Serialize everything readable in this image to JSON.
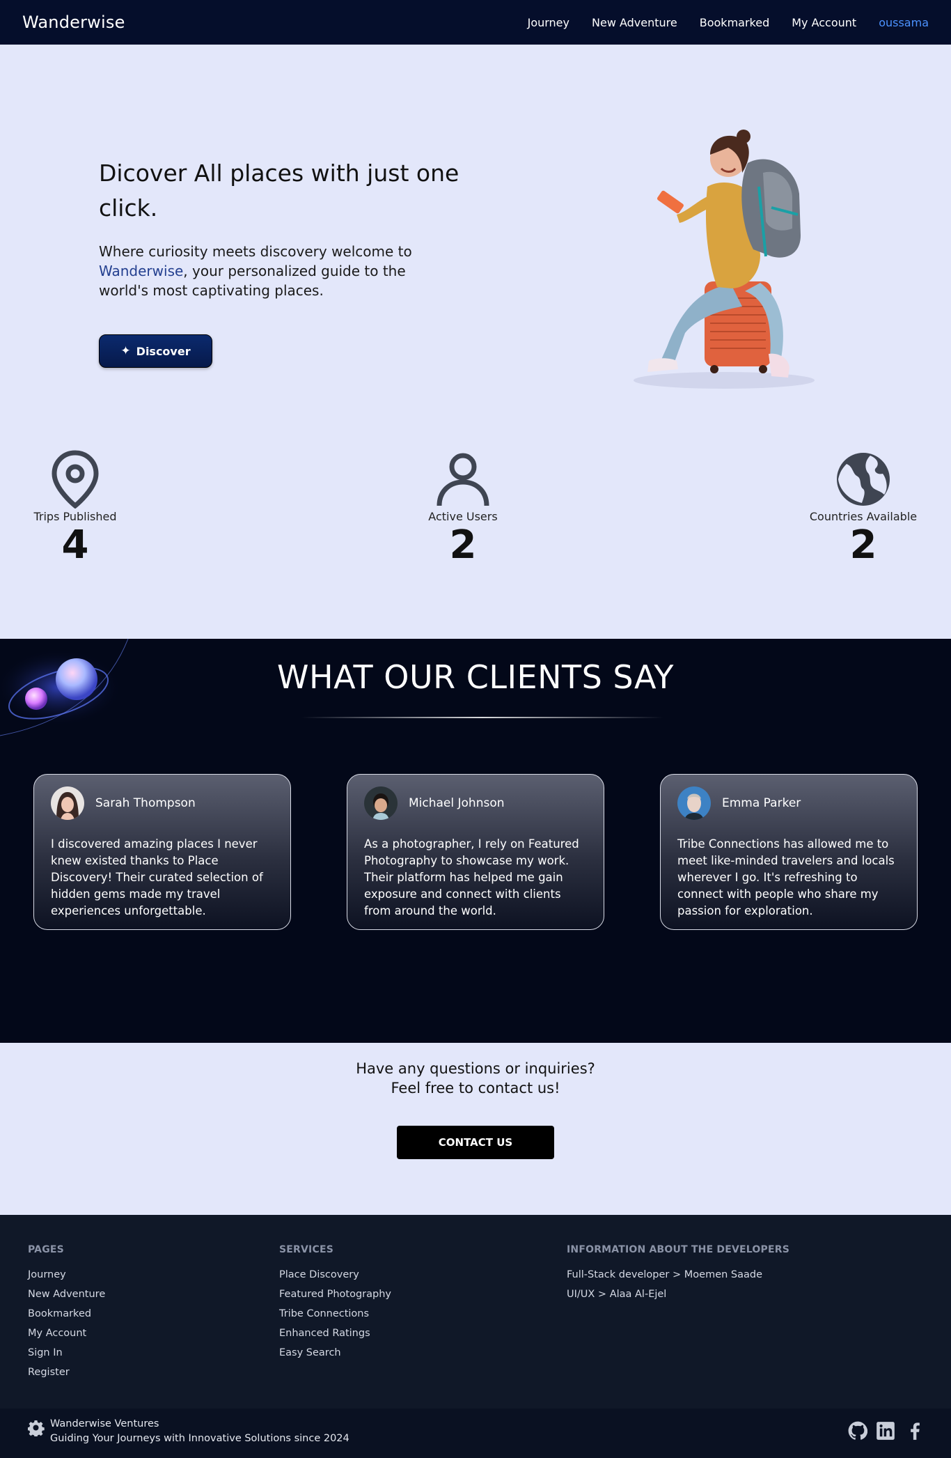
{
  "nav": {
    "brand": "Wanderwise",
    "links": [
      "Journey",
      "New Adventure",
      "Bookmarked",
      "My Account"
    ],
    "user": "oussama"
  },
  "hero": {
    "title": "Dicover All places with just one click.",
    "text_before": "Where curiosity meets discovery welcome to ",
    "text_highlight": "Wanderwise",
    "text_after": ", your personalized guide to the world's most captivating places.",
    "discover_label": "Discover",
    "illustration": "traveler-with-backpack-on-suitcase"
  },
  "stats": [
    {
      "icon": "map-pin-icon",
      "label": "Trips Published",
      "value": "4"
    },
    {
      "icon": "user-icon",
      "label": "Active Users",
      "value": "2"
    },
    {
      "icon": "globe-icon",
      "label": "Countries Available",
      "value": "2"
    }
  ],
  "clients": {
    "title": "WHAT OUR CLIENTS SAY",
    "testimonials": [
      {
        "name": "Sarah Thompson",
        "text": "I discovered amazing places I never knew existed thanks to Place Discovery! Their curated selection of hidden gems made my travel experiences unforgettable."
      },
      {
        "name": "Michael Johnson",
        "text": "As a photographer, I rely on Featured Photography to showcase my work. Their platform has helped me gain exposure and connect with clients from around the world."
      },
      {
        "name": "Emma Parker",
        "text": "Tribe Connections has allowed me to meet like-minded travelers and locals wherever I go. It's refreshing to connect with people who share my passion for exploration."
      }
    ]
  },
  "contact": {
    "line1": "Have any questions or inquiries?",
    "line2": "Feel free to contact us!",
    "button_label": "CONTACT US"
  },
  "footer": {
    "pages_heading": "PAGES",
    "pages": [
      "Journey",
      "New Adventure",
      "Bookmarked",
      "My Account",
      "Sign In",
      "Register"
    ],
    "services_heading": "SERVICES",
    "services": [
      "Place Discovery",
      "Featured Photography",
      "Tribe Connections",
      "Enhanced Ratings",
      "Easy Search"
    ],
    "devs_heading": "INFORMATION ABOUT THE DEVELOPERS",
    "devs": [
      "Full-Stack developer  > Moemen Saade",
      "UI/UX > Alaa Al-Ejel"
    ],
    "company": "Wanderwise Ventures",
    "tagline": "Guiding Your Journeys with Innovative Solutions since 2024",
    "social_icons": [
      "github-icon",
      "linkedin-icon",
      "facebook-icon"
    ]
  },
  "colors": {
    "nav_bg": "#050e2b",
    "page_bg": "#e3e7fa",
    "accent_user": "#4c92ff",
    "hero_highlight": "#233f8f",
    "clients_bg": "#030819",
    "footer_bg": "#101828"
  }
}
